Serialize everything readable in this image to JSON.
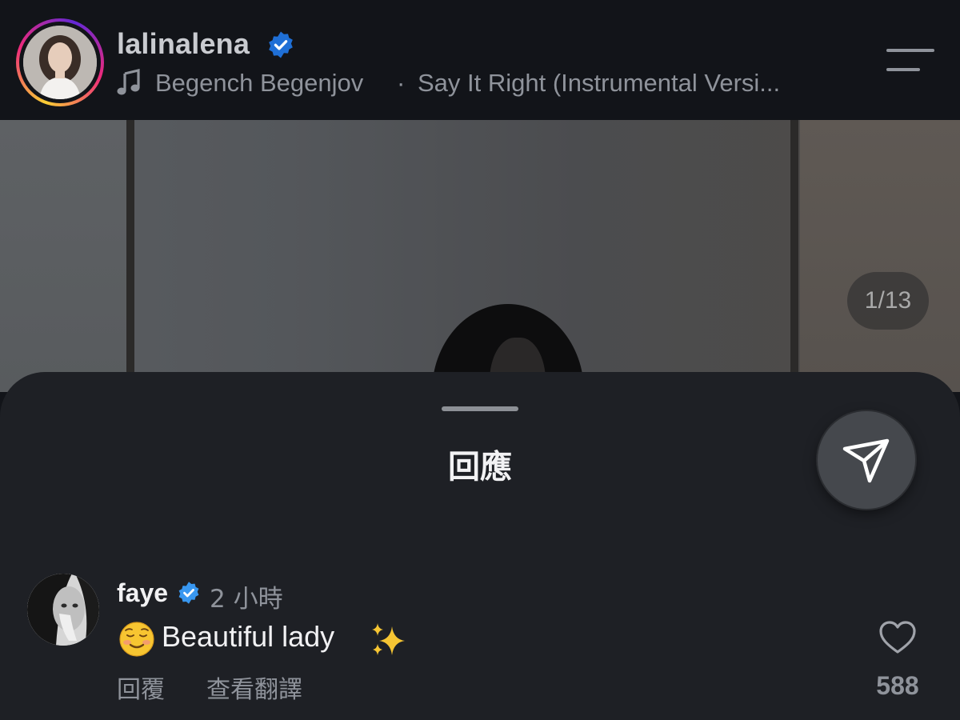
{
  "header": {
    "username": "lalinalena",
    "verified": true,
    "music": {
      "artist": "Begench Begenjov",
      "separator": "·",
      "title": "Say It Right (Instrumental Versi..."
    },
    "icons": {
      "music": "music-note-icon",
      "menu": "menu-lines-icon",
      "verified": "verified-badge-icon"
    }
  },
  "post": {
    "page_counter": "1/13"
  },
  "sheet": {
    "title": "回應",
    "share_icon": "send-icon"
  },
  "comment": {
    "username": "faye",
    "verified": true,
    "time": "2 小時",
    "emoji": "☺️",
    "text": "Beautiful lady",
    "trailing_emoji": "✨",
    "reply_label": "回覆",
    "translate_label": "查看翻譯",
    "like_count": "588",
    "like_icon": "heart-icon"
  },
  "colors": {
    "verified_blue": "#3897f0",
    "background": "#121419",
    "sheet": "#1e2025"
  }
}
